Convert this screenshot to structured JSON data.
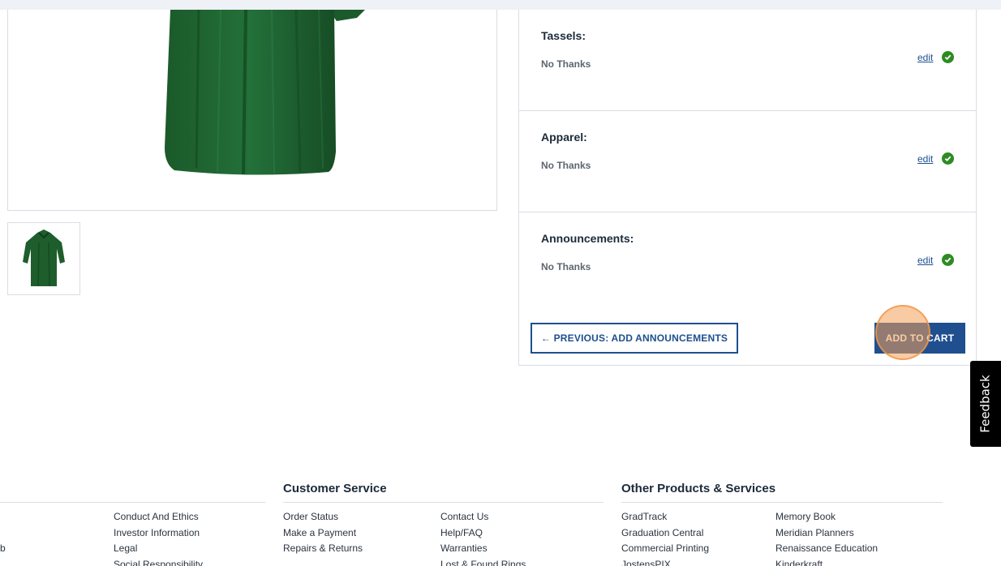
{
  "sections": [
    {
      "title": "Tassels:",
      "value": "No Thanks",
      "edit": "edit"
    },
    {
      "title": "Apparel:",
      "value": "No Thanks",
      "edit": "edit"
    },
    {
      "title": "Announcements:",
      "value": "No Thanks",
      "edit": "edit"
    }
  ],
  "buttons": {
    "previous": "← PREVIOUS: ADD ANNOUNCEMENTS",
    "add_to_cart": "ADD TO CART"
  },
  "feedback": "Feedback",
  "footer": {
    "left_partial": {
      "edge_fragment": "b",
      "links": [
        "Conduct And Ethics",
        "Investor Information",
        "Legal",
        "Social Responsibility"
      ]
    },
    "customer_service": {
      "heading": "Customer Service",
      "col1": [
        "Order Status",
        "Make a Payment",
        "Repairs & Returns"
      ],
      "col2": [
        "Contact Us",
        "Help/FAQ",
        "Warranties",
        "Lost & Found Rings"
      ]
    },
    "other_products": {
      "heading": "Other Products & Services",
      "col1": [
        "GradTrack",
        "Graduation Central",
        "Commercial Printing",
        "JostensPIX"
      ],
      "col2": [
        "Memory Book",
        "Meridian Planners",
        "Renaissance Education",
        "Kinderkraft"
      ]
    }
  },
  "colors": {
    "gown_green": "#1e5e2c",
    "brand_blue": "#1f4f8f",
    "check_green": "#2e8b23"
  }
}
